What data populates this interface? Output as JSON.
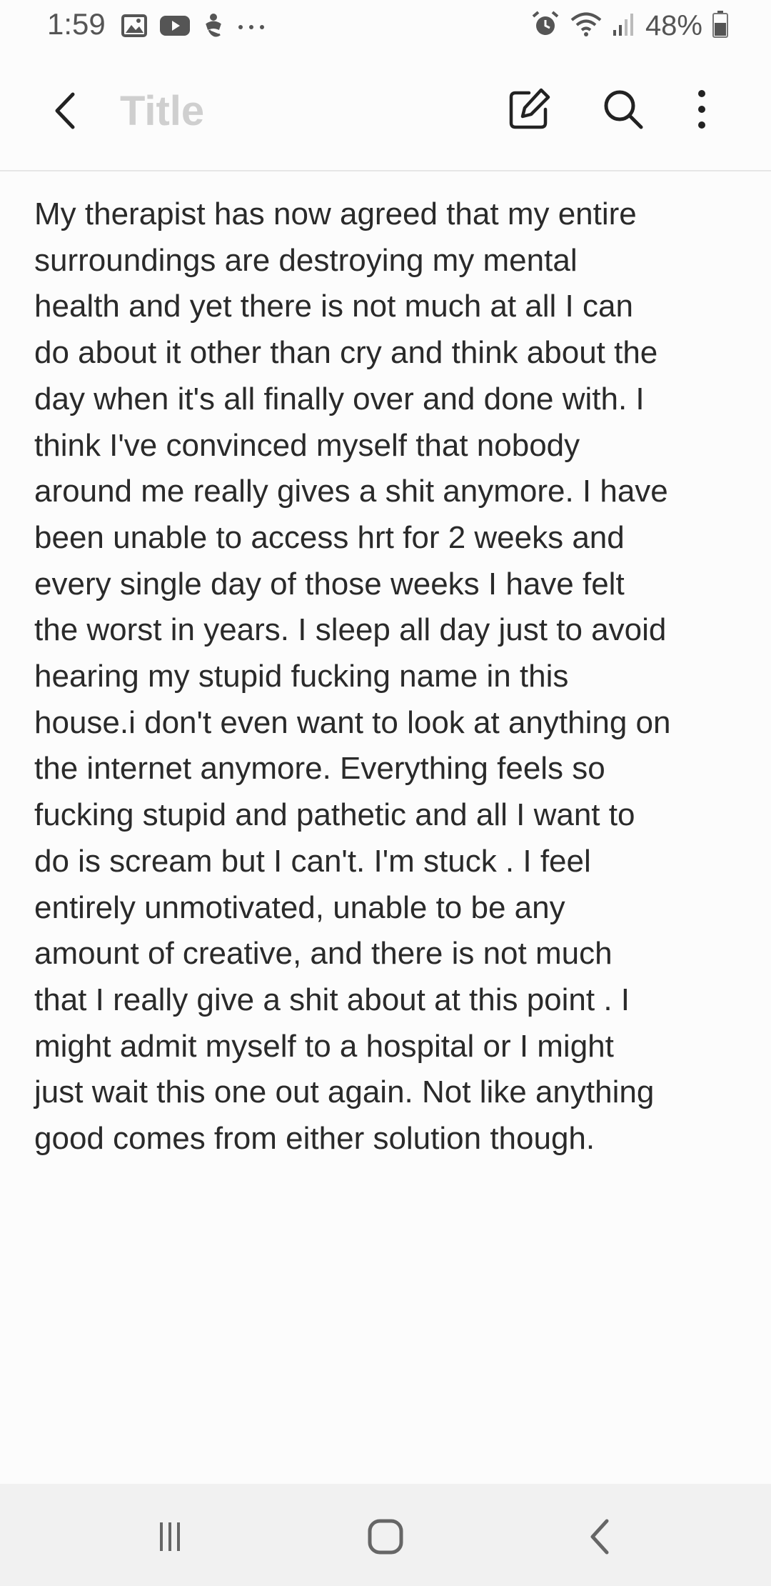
{
  "status_bar": {
    "time": "1:59",
    "battery_percent": "48%",
    "left_icons": [
      "gallery-icon",
      "youtube-icon",
      "accessibility-icon",
      "more-dots-icon"
    ],
    "right_icons": [
      "alarm-icon",
      "wifi-icon",
      "signal-icon",
      "battery-icon"
    ]
  },
  "app_bar": {
    "title_value": "",
    "title_placeholder": "Title",
    "actions": [
      "edit-icon",
      "search-icon",
      "more-vert-icon"
    ]
  },
  "note": {
    "body": "My therapist has now agreed that my entire\nsurroundings are destroying my mental\nhealth and yet there is not much at all I can\ndo about it other than cry and think about the\nday when it's all finally over and done with. I\nthink I've convinced myself that nobody\naround me really gives a shit anymore. I have\nbeen unable to access hrt for 2 weeks and\nevery single day of those weeks I have felt\nthe worst in years. I sleep all day just to avoid\nhearing my stupid fucking name in this\nhouse.i don't even want to look at anything on\nthe internet anymore. Everything feels so\nfucking stupid and pathetic and all I want to\ndo is scream but I can't. I'm stuck . I feel\nentirely unmotivated, unable to be any\namount of creative, and there is not much\nthat I really give a shit about at this point . I\nmight admit myself to a hospital or I might\njust wait this one out again. Not like anything\ngood comes from either solution though."
  },
  "nav_bar": {
    "buttons": [
      "recents-icon",
      "home-icon",
      "back-icon"
    ]
  },
  "colors": {
    "background": "#fcfcfc",
    "text": "#2a2a2a",
    "placeholder": "#cfcfcf",
    "nav_background": "#f1f1f1"
  }
}
